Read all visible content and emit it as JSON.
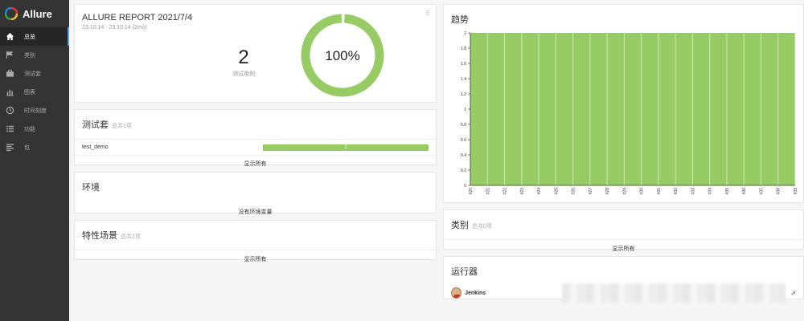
{
  "app": {
    "name": "Allure"
  },
  "colors": {
    "passed": "#97cc64",
    "sidebar": "#343434",
    "accent": "#5fa2dd"
  },
  "sidebar": {
    "items": [
      {
        "label": "总览",
        "icon": "home-icon",
        "active": true
      },
      {
        "label": "类别",
        "icon": "flag-icon"
      },
      {
        "label": "测试套",
        "icon": "briefcase-icon"
      },
      {
        "label": "图表",
        "icon": "bar-chart-icon"
      },
      {
        "label": "时间刻度",
        "icon": "clock-icon"
      },
      {
        "label": "功能",
        "icon": "list-icon"
      },
      {
        "label": "包",
        "icon": "align-left-icon"
      }
    ]
  },
  "summary": {
    "title": "ALLURE REPORT 2021/7/4",
    "time": "23:10:14 - 23:10:14 (2ms)",
    "count": "2",
    "count_label": "测试用例",
    "percent": "100%",
    "pass_rate": 100
  },
  "suites": {
    "title": "测试套",
    "subtitle": "总共1项",
    "rows": [
      {
        "name": "test_demo",
        "value": "2"
      }
    ],
    "show_all": "显示所有"
  },
  "environment": {
    "title": "环境",
    "empty": "没有环境变量"
  },
  "features": {
    "title": "特性场景",
    "subtitle": "总共2项",
    "show_all": "显示所有"
  },
  "trend": {
    "title": "趋势"
  },
  "categories": {
    "title": "类别",
    "subtitle": "总共0项",
    "show_all": "显示所有"
  },
  "executors": {
    "title": "运行器",
    "rows": [
      {
        "name": "Jenkins"
      }
    ]
  },
  "chart_data": {
    "type": "area",
    "title": "趋势",
    "x": [
      "#20",
      "#21",
      "#22",
      "#23",
      "#24",
      "#25",
      "#26",
      "#27",
      "#28",
      "#29",
      "#30",
      "#31",
      "#32",
      "#33",
      "#34",
      "#35",
      "#36",
      "#37",
      "#38",
      "#39"
    ],
    "series": [
      {
        "values": [
          2,
          2,
          2,
          2,
          2,
          2,
          2,
          2,
          2,
          2,
          2,
          2,
          2,
          2,
          2,
          2,
          2,
          2,
          2,
          2
        ]
      }
    ],
    "yticks": [
      "0",
      "0.2",
      "0.4",
      "0.6",
      "0.8",
      "1",
      "1.2",
      "1.4",
      "1.6",
      "1.8",
      "2"
    ],
    "ylim": [
      0,
      2
    ],
    "grid": true
  }
}
